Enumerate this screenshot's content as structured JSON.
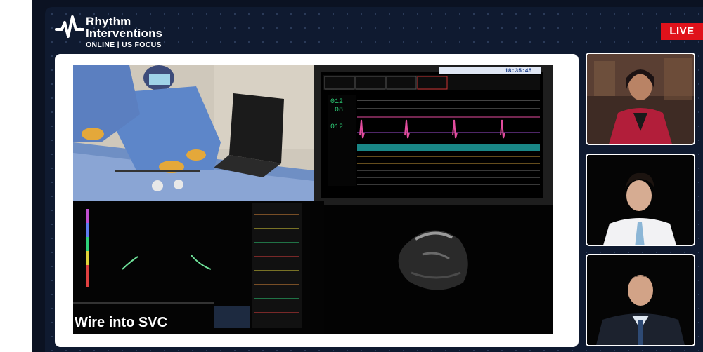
{
  "brand": {
    "name_line1": "Rhythm",
    "name_line2": "Interventions",
    "subtitle": "ONLINE | US FOCUS",
    "accent": "#ffffff"
  },
  "live_badge": {
    "label": "LIVE",
    "color": "#e0121b"
  },
  "monitor": {
    "clock": "18:35:45",
    "readout_1": "012",
    "readout_2": "08",
    "readout_3": "012"
  },
  "caption": "Wire into SVC",
  "speakers": [
    {
      "role": "host",
      "attire": "red blazer"
    },
    {
      "role": "panelist",
      "attire": "white shirt"
    },
    {
      "role": "panelist",
      "attire": "dark suit"
    }
  ]
}
